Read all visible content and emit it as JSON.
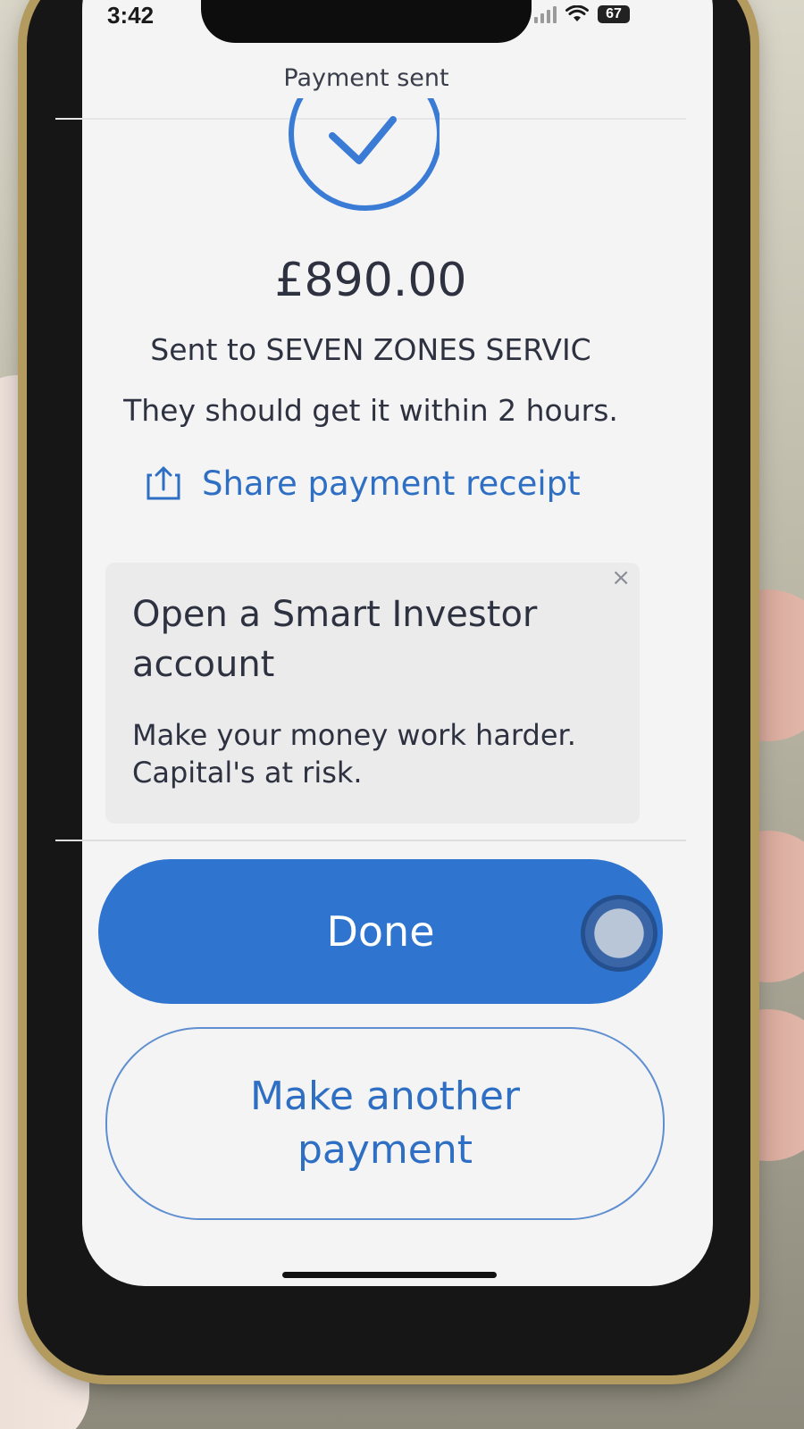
{
  "status_bar": {
    "time": "3:42",
    "battery": "67",
    "icons": [
      "signal-icon",
      "wifi-icon",
      "battery-icon"
    ]
  },
  "header": {
    "title": "Payment sent"
  },
  "confirmation": {
    "icon": "checkmark-circle-icon",
    "amount": "£890.00",
    "recipient_line": "Sent to SEVEN ZONES SERVIC",
    "eta_line": "They should get it within 2 hours.",
    "share_label": "Share payment receipt",
    "share_icon": "share-icon"
  },
  "promo": {
    "title": "Open a Smart Investor account",
    "body": "Make your money work harder. Capital's at risk.",
    "close_icon": "close-icon",
    "close_glyph": "×"
  },
  "actions": {
    "done_label": "Done",
    "another_label": "Make another payment"
  },
  "colors": {
    "accent": "#2f74cf",
    "link": "#2e6fc4",
    "text": "#2e3240",
    "background": "#f4f4f5"
  }
}
